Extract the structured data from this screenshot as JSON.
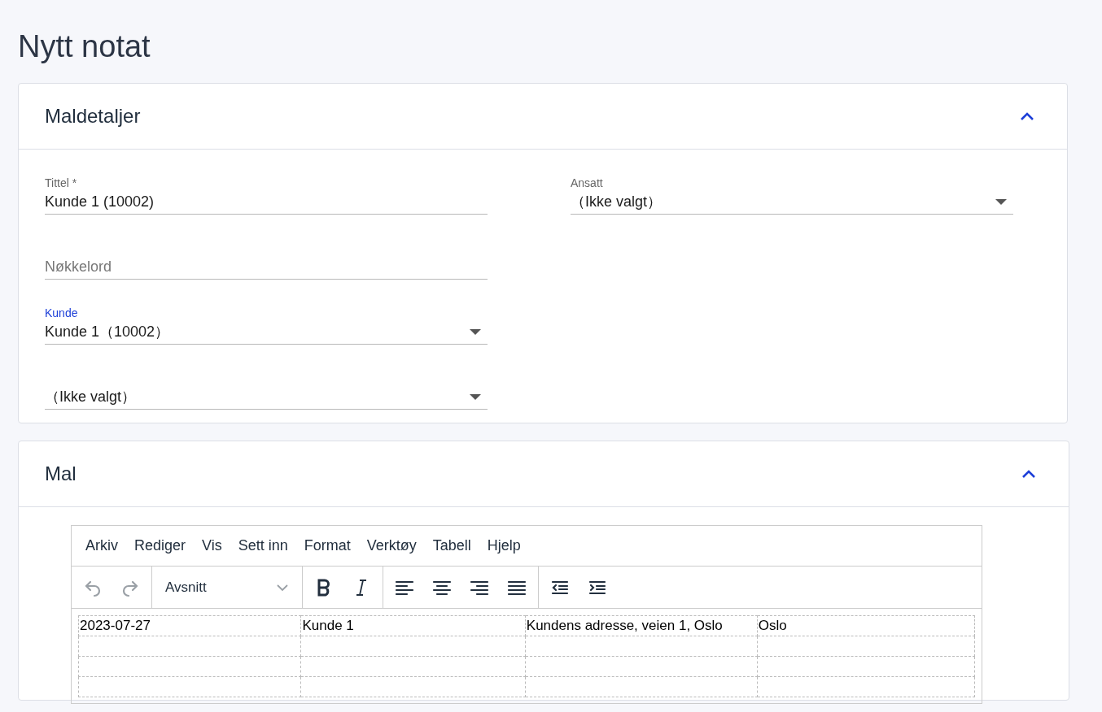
{
  "page_title": "Nytt notat",
  "details": {
    "title": "Maldetaljer",
    "expanded": true,
    "left_fields": [
      {
        "kind": "text",
        "label": "Tittel *",
        "value": "Kunde 1 (10002)",
        "focused": false
      },
      {
        "kind": "text",
        "placeholder": "Nøkkelord",
        "focused": false
      },
      {
        "kind": "select",
        "label": "Kunde",
        "value": "Kunde 1（10002）",
        "focused": true
      },
      {
        "kind": "select",
        "value": "（Ikke valgt）",
        "focused": false
      }
    ],
    "right_fields": [
      {
        "kind": "select",
        "label": "Ansatt",
        "value": "（Ikke valgt）",
        "focused": false
      }
    ]
  },
  "template": {
    "title": "Mal",
    "expanded": true,
    "menu": [
      "Arkiv",
      "Rediger",
      "Vis",
      "Sett inn",
      "Format",
      "Verktøy",
      "Tabell",
      "Hjelp"
    ],
    "toolbar": [
      [
        {
          "kind": "undo",
          "disabled": true
        },
        {
          "kind": "redo",
          "disabled": true
        }
      ],
      [
        {
          "kind": "block",
          "label": "Avsnitt",
          "disabled": false
        }
      ],
      [
        {
          "kind": "bold",
          "disabled": false
        },
        {
          "kind": "italic",
          "disabled": false
        }
      ],
      [
        {
          "kind": "align-left",
          "disabled": false
        },
        {
          "kind": "align-center",
          "disabled": false
        },
        {
          "kind": "align-right",
          "disabled": false
        },
        {
          "kind": "justify",
          "disabled": false
        }
      ],
      [
        {
          "kind": "outdent",
          "disabled": false
        },
        {
          "kind": "indent",
          "disabled": false
        }
      ]
    ],
    "table_rows": [
      [
        "2023-07-27",
        "Kunde 1",
        "Kundens adresse, veien 1, Oslo",
        "Oslo"
      ],
      [
        "",
        "",
        "",
        ""
      ],
      [
        "",
        "",
        "",
        ""
      ],
      [
        "",
        "",
        "",
        ""
      ]
    ]
  }
}
